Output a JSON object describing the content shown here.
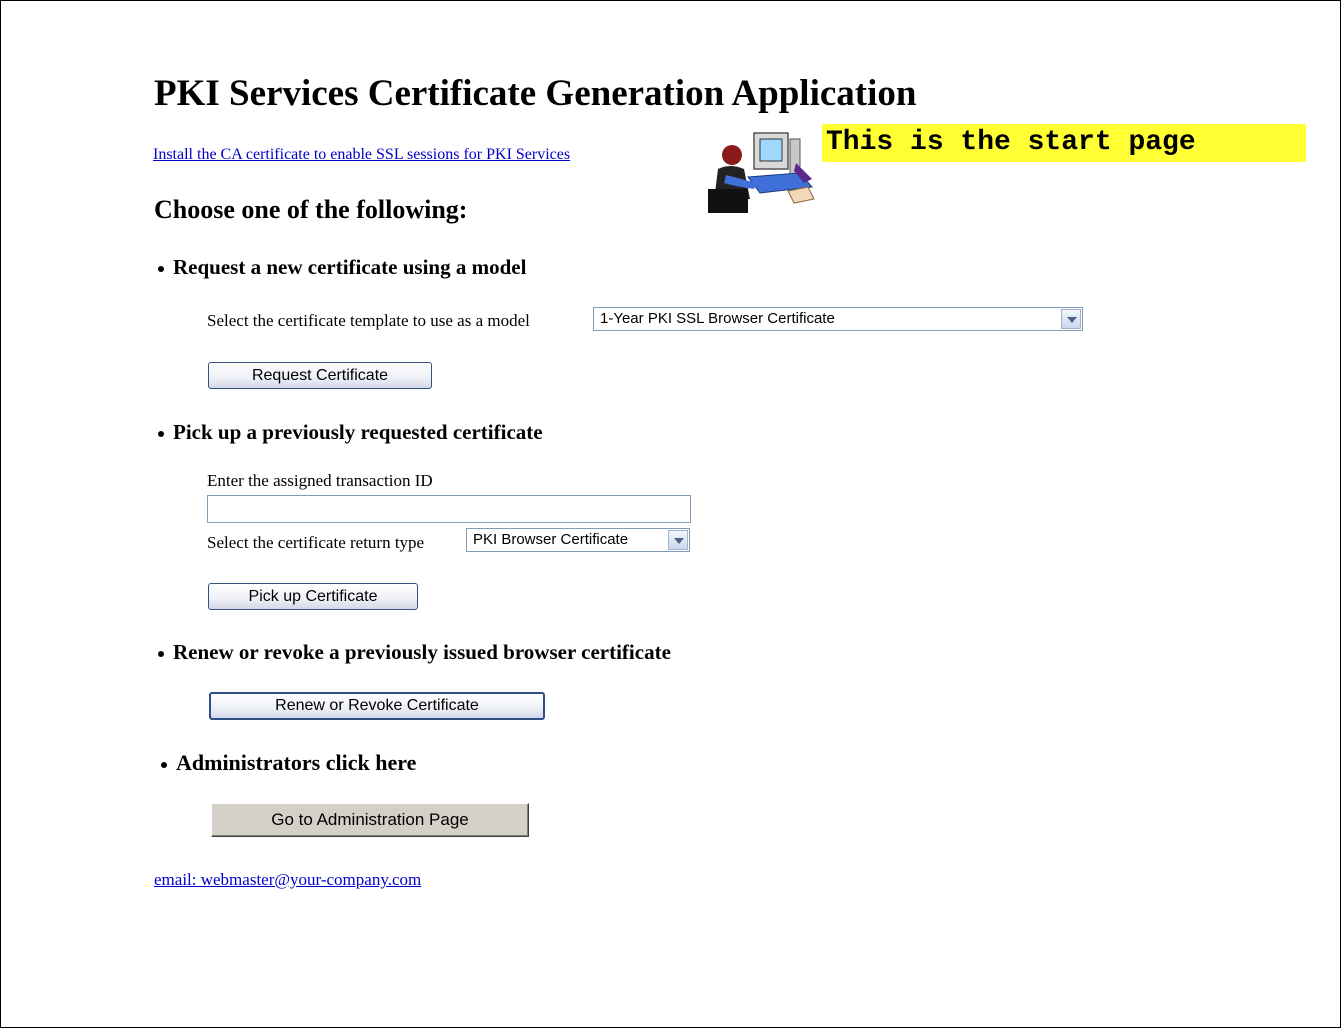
{
  "header": {
    "title": "PKI Services Certificate Generation Application",
    "ca_link": "Install the CA certificate to enable SSL sessions for PKI Services",
    "banner": "This is the start page",
    "clipart_icon": "person-at-computer-icon"
  },
  "choose_heading": "Choose one of the following:",
  "request": {
    "heading": "Request a new certificate using a model",
    "select_label": "Select the certificate template to use as a model",
    "template_value": "1-Year PKI SSL Browser Certificate",
    "button": "Request Certificate"
  },
  "pickup": {
    "heading": "Pick up a previously requested certificate",
    "id_label": "Enter the assigned transaction ID",
    "id_value": "",
    "return_label": "Select the certificate return type",
    "return_value": "PKI Browser Certificate",
    "button": "Pick up Certificate"
  },
  "renew": {
    "heading": "Renew or revoke a previously issued browser certificate",
    "button": "Renew or Revoke Certificate"
  },
  "admin": {
    "heading": "Administrators click here",
    "button": "Go to Administration Page"
  },
  "footer": {
    "email": "email: webmaster@your-company.com"
  },
  "colors": {
    "banner_bg": "#ffff33",
    "link": "#0000cc"
  }
}
